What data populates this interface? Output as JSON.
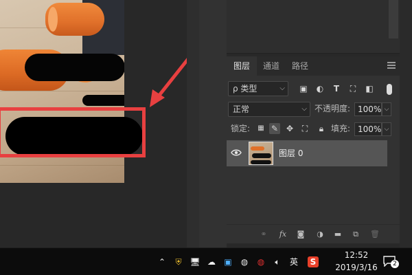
{
  "ime_bubble": {
    "char": "英",
    "comma": ","
  },
  "layers_panel": {
    "tabs": [
      {
        "label": "图层",
        "active": true
      },
      {
        "label": "通道",
        "active": false
      },
      {
        "label": "路径",
        "active": false
      }
    ],
    "filter": {
      "label": "ρ 类型"
    },
    "blend_mode": {
      "value": "正常"
    },
    "opacity": {
      "label": "不透明度:",
      "value": "100%"
    },
    "lock": {
      "label": "锁定:"
    },
    "fill": {
      "label": "填充:",
      "value": "100%"
    },
    "layers": [
      {
        "name": "图层 0",
        "visible": true
      }
    ],
    "bottom_icons": [
      "link-icon",
      "fx-icon",
      "mask-icon",
      "adjustment-icon",
      "folder-icon",
      "new-layer-icon",
      "trash-icon"
    ],
    "fx_label": "fx"
  },
  "taskbar": {
    "ime_label": "英",
    "time": "12:52",
    "date": "2019/3/16",
    "notification_count": "2"
  },
  "colors": {
    "highlight_box": "#e84040",
    "panel_bg": "#323232",
    "taskbar_bg": "#0c0c0c"
  }
}
